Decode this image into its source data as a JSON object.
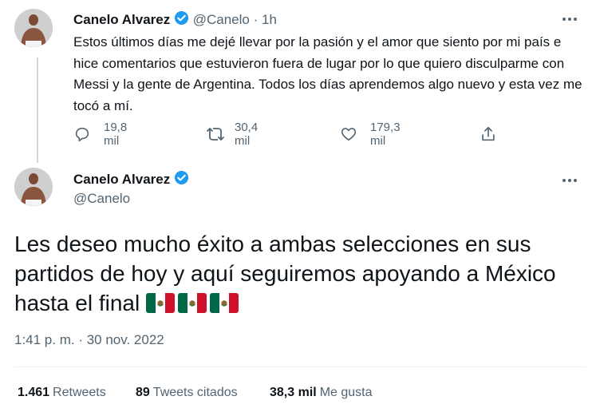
{
  "tweet1": {
    "display_name": "Canelo Alvarez",
    "handle": "@Canelo",
    "separator": "·",
    "time_ago": "1h",
    "text": "Estos últimos días me dejé llevar por la pasión y el amor que siento por mi país e hice comentarios que estuvieron fuera de lugar por lo que quiero disculparme con Messi y la gente de Argentina. Todos los días aprendemos algo nuevo y esta vez me tocó a mí.",
    "replies": "19,8 mil",
    "retweets": "30,4 mil",
    "likes": "179,3 mil"
  },
  "tweet2": {
    "display_name": "Canelo Alvarez",
    "handle": "@Canelo",
    "text": "Les deseo mucho éxito a ambas selecciones en sus partidos de hoy y aquí seguiremos apoyando a México hasta el final",
    "flags": [
      "mexico-flag",
      "mexico-flag",
      "mexico-flag"
    ],
    "timestamp": "1:41 p. m. · 30 nov. 2022",
    "stats": {
      "retweets_count": "1.461",
      "retweets_label": "Retweets",
      "quotes_count": "89",
      "quotes_label": "Tweets citados",
      "likes_count": "38,3 mil",
      "likes_label": "Me gusta"
    }
  },
  "colors": {
    "verified": "#1d9bf0",
    "muted": "#536471",
    "text": "#0f1419",
    "thread_line": "#cfd9de",
    "divider": "#eff3f4",
    "flag_green": "#006847",
    "flag_red": "#ce1126"
  }
}
